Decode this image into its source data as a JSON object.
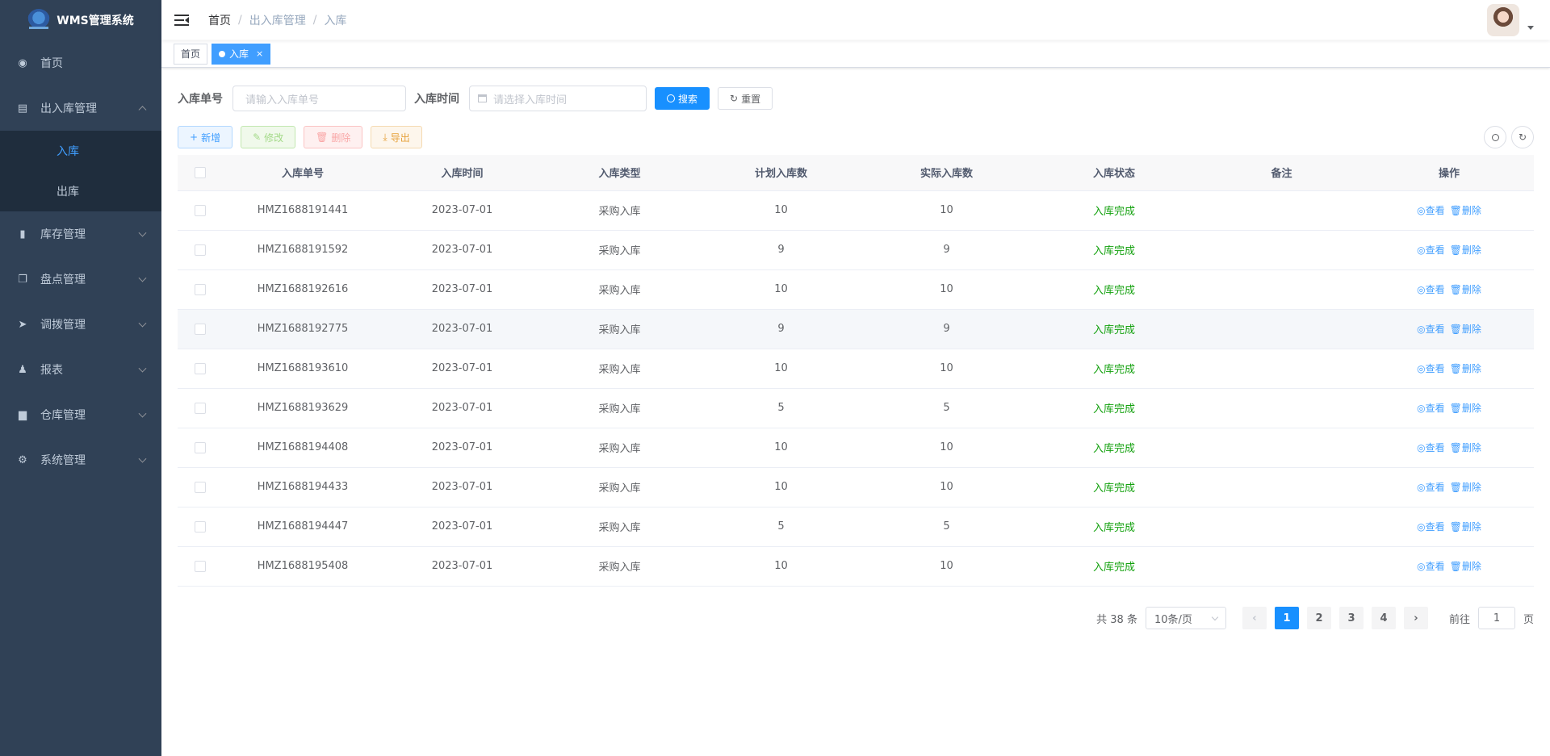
{
  "app": {
    "title": "WMS管理系统"
  },
  "sidebar": {
    "items": [
      {
        "label": "首页",
        "icon": "dashboard-icon"
      },
      {
        "label": "出入库管理",
        "icon": "document-icon",
        "expanded": true,
        "children": [
          {
            "label": "入库",
            "active": true
          },
          {
            "label": "出库"
          }
        ]
      },
      {
        "label": "库存管理",
        "icon": "bar-chart-icon"
      },
      {
        "label": "盘点管理",
        "icon": "copy-icon"
      },
      {
        "label": "调拨管理",
        "icon": "send-icon"
      },
      {
        "label": "报表",
        "icon": "user-icon"
      },
      {
        "label": "仓库管理",
        "icon": "folder-icon"
      },
      {
        "label": "系统管理",
        "icon": "gear-icon"
      }
    ]
  },
  "breadcrumb": [
    "首页",
    "出入库管理",
    "入库"
  ],
  "tags": [
    {
      "label": "首页"
    },
    {
      "label": "入库",
      "active": true,
      "close": "×"
    }
  ],
  "search": {
    "no_label": "入库单号",
    "no_placeholder": "请输入入库单号",
    "time_label": "入库时间",
    "time_placeholder": "请选择入库时间",
    "search_btn": "搜索",
    "reset_btn": "重置"
  },
  "toolbar": {
    "add": "新增",
    "edit": "修改",
    "delete": "删除",
    "export": "导出"
  },
  "table": {
    "headers": [
      "入库单号",
      "入库时间",
      "入库类型",
      "计划入库数",
      "实际入库数",
      "入库状态",
      "备注",
      "操作"
    ],
    "rows": [
      [
        "HMZ1688191441",
        "2023-07-01",
        "采购入库",
        "10",
        "10",
        "入库完成",
        ""
      ],
      [
        "HMZ1688191592",
        "2023-07-01",
        "采购入库",
        "9",
        "9",
        "入库完成",
        ""
      ],
      [
        "HMZ1688192616",
        "2023-07-01",
        "采购入库",
        "10",
        "10",
        "入库完成",
        ""
      ],
      [
        "HMZ1688192775",
        "2023-07-01",
        "采购入库",
        "9",
        "9",
        "入库完成",
        ""
      ],
      [
        "HMZ1688193610",
        "2023-07-01",
        "采购入库",
        "10",
        "10",
        "入库完成",
        ""
      ],
      [
        "HMZ1688193629",
        "2023-07-01",
        "采购入库",
        "5",
        "5",
        "入库完成",
        ""
      ],
      [
        "HMZ1688194408",
        "2023-07-01",
        "采购入库",
        "10",
        "10",
        "入库完成",
        ""
      ],
      [
        "HMZ1688194433",
        "2023-07-01",
        "采购入库",
        "10",
        "10",
        "入库完成",
        ""
      ],
      [
        "HMZ1688194447",
        "2023-07-01",
        "采购入库",
        "5",
        "5",
        "入库完成",
        ""
      ],
      [
        "HMZ1688195408",
        "2023-07-01",
        "采购入库",
        "10",
        "10",
        "入库完成",
        ""
      ]
    ],
    "hover_row": 3,
    "ops": {
      "view": "查看",
      "delete": "删除"
    }
  },
  "pagination": {
    "total": "共 38 条",
    "page_size": "10条/页",
    "pages": [
      "1",
      "2",
      "3",
      "4"
    ],
    "current": "1",
    "goto_prefix": "前往",
    "goto_value": "1",
    "goto_suffix": "页"
  },
  "colors": {
    "sidebar_bg": "#304156",
    "primary": "#1890ff",
    "status_done": "#13a10e"
  }
}
